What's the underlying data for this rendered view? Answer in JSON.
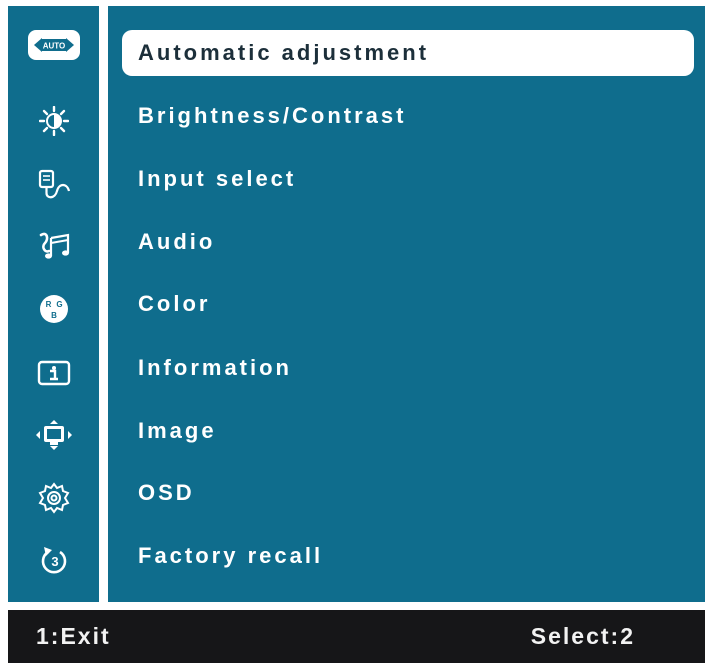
{
  "menu": {
    "items": [
      {
        "label": "Automatic adjustment",
        "icon": "auto-adjust-icon",
        "selected": true
      },
      {
        "label": "Brightness/Contrast",
        "icon": "brightness-icon",
        "selected": false
      },
      {
        "label": "Input select",
        "icon": "input-select-icon",
        "selected": false
      },
      {
        "label": "Audio",
        "icon": "audio-icon",
        "selected": false
      },
      {
        "label": "Color",
        "icon": "rgb-color-icon",
        "selected": false
      },
      {
        "label": "Information",
        "icon": "information-icon",
        "selected": false
      },
      {
        "label": "Image",
        "icon": "image-icon",
        "selected": false
      },
      {
        "label": "OSD",
        "icon": "osd-gear-icon",
        "selected": false
      },
      {
        "label": "Factory recall",
        "icon": "factory-recall-icon",
        "selected": false
      }
    ],
    "auto_icon_text": "AUTO"
  },
  "status": {
    "exit": "1:Exit",
    "select": "Select:2"
  },
  "colors": {
    "panel": "#0f6d8d",
    "status_bar": "#161618",
    "selected_bg": "#ffffff",
    "text": "#ffffff"
  }
}
